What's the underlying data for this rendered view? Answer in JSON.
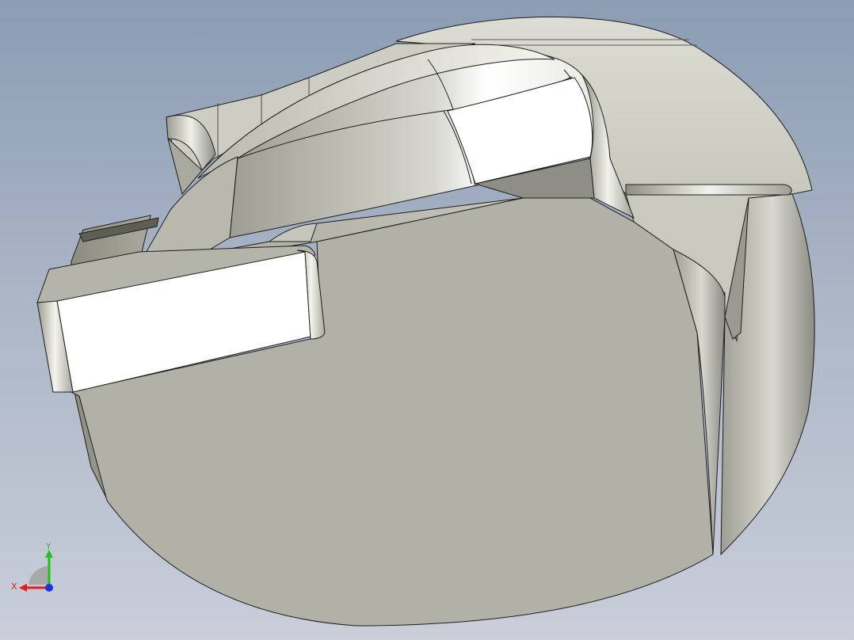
{
  "viewport": {
    "background_top": "#8b9cb3",
    "background_bottom": "#c9ced9",
    "model_color": "#b1b1a8",
    "highlight_color": "#ffffff",
    "edge_color": "#1e1e1e"
  },
  "triad": {
    "x_label": "X",
    "y_label": "Y",
    "x_color": "#e02020",
    "y_color": "#20c020",
    "z_color": "#2030e0"
  }
}
